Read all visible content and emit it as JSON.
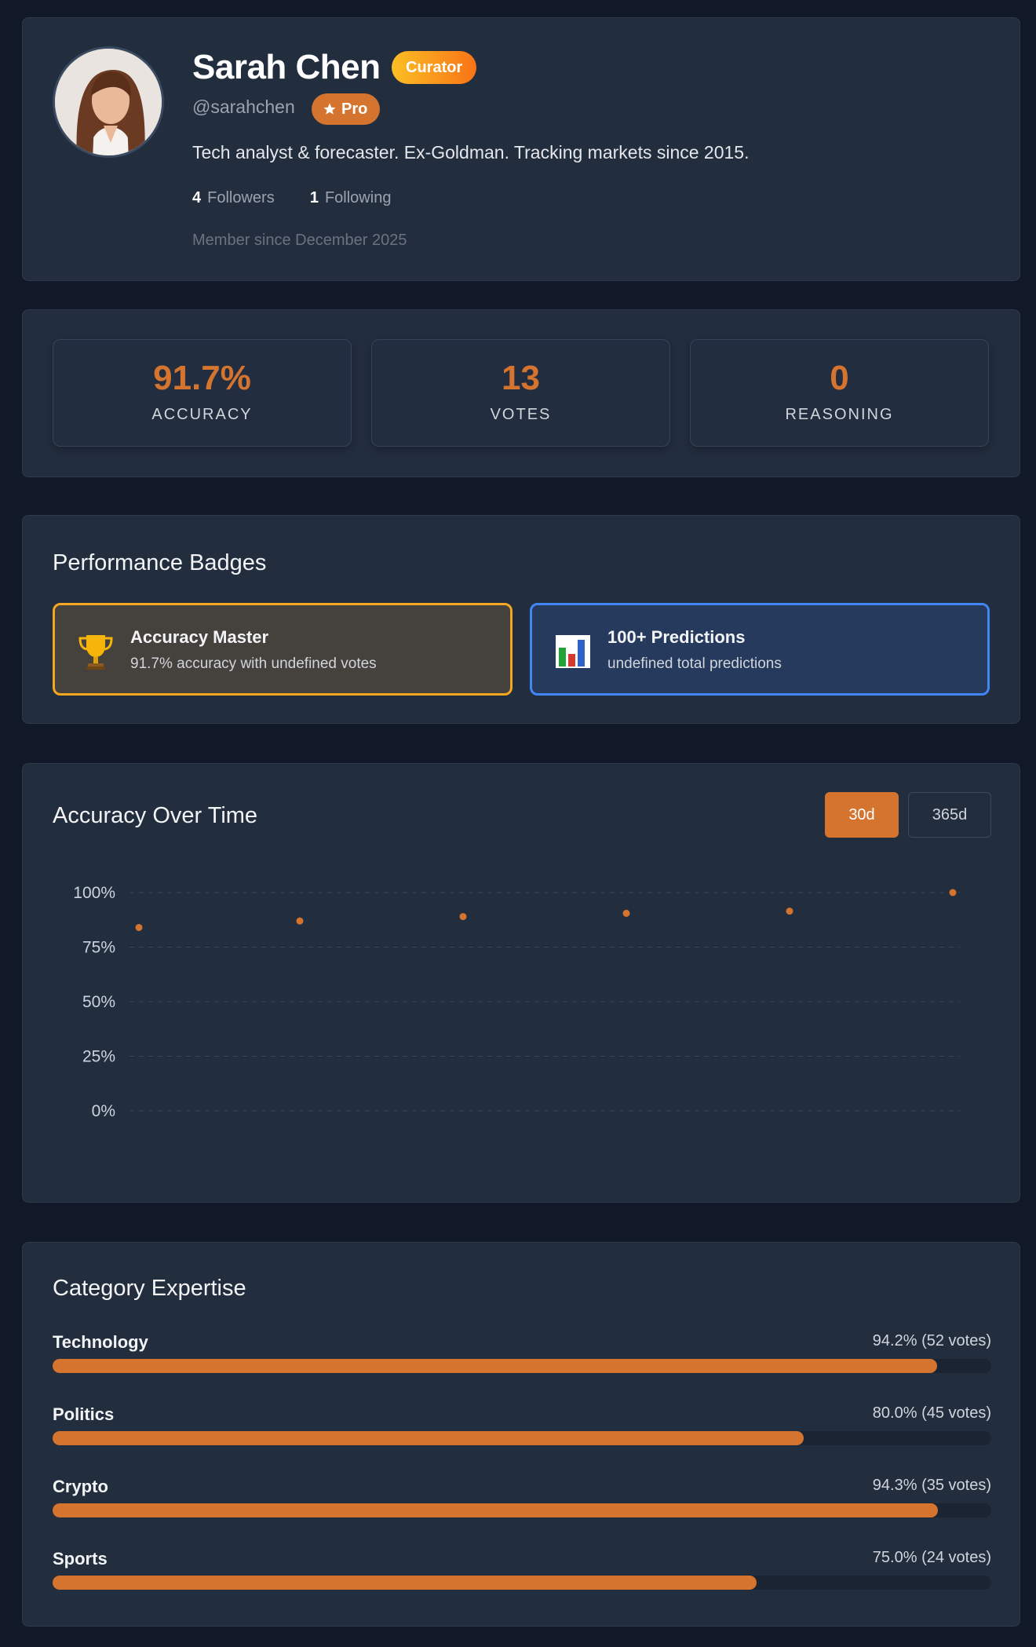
{
  "profile": {
    "name": "Sarah Chen",
    "role_badge": "Curator",
    "handle": "@sarahchen",
    "tier_badge": "Pro",
    "bio": "Tech analyst & forecaster. Ex-Goldman. Tracking markets since 2015.",
    "followers_count": "4",
    "followers_label": "Followers",
    "following_count": "1",
    "following_label": "Following",
    "member_since": "Member since December 2025"
  },
  "stats": [
    {
      "value": "91.7%",
      "label": "ACCURACY"
    },
    {
      "value": "13",
      "label": "VOTES"
    },
    {
      "value": "0",
      "label": "REASONING"
    }
  ],
  "badges": {
    "title": "Performance Badges",
    "items": [
      {
        "icon": "trophy-icon",
        "title": "Accuracy Master",
        "subtitle": "91.7% accuracy with undefined votes"
      },
      {
        "icon": "bar-chart-icon",
        "title": "100+ Predictions",
        "subtitle": "undefined total predictions"
      }
    ]
  },
  "accuracy_chart": {
    "title": "Accuracy Over Time",
    "ranges": [
      "30d",
      "365d"
    ],
    "selected_range": "30d"
  },
  "chart_data": {
    "type": "scatter",
    "title": "Accuracy Over Time",
    "xlabel": "",
    "ylabel": "",
    "y_ticks": [
      "100%",
      "75%",
      "50%",
      "25%",
      "0%"
    ],
    "ylim": [
      0,
      100
    ],
    "grid": true,
    "series": [
      {
        "values": [
          84,
          87,
          89,
          90.5,
          91.5,
          100
        ]
      }
    ],
    "color": "#d4742e"
  },
  "categories": {
    "title": "Category Expertise",
    "items": [
      {
        "name": "Technology",
        "stat": "94.2% (52 votes)",
        "accuracy": 94.2
      },
      {
        "name": "Politics",
        "stat": "80.0% (45 votes)",
        "accuracy": 80.0
      },
      {
        "name": "Crypto",
        "stat": "94.3% (35 votes)",
        "accuracy": 94.3
      },
      {
        "name": "Sports",
        "stat": "75.0% (24 votes)",
        "accuracy": 75.0
      }
    ]
  },
  "colors": {
    "accent": "#d4742e",
    "background": "#111827",
    "card": "#222d3e",
    "gold_border": "#f5a623",
    "blue_border": "#4285f4"
  }
}
